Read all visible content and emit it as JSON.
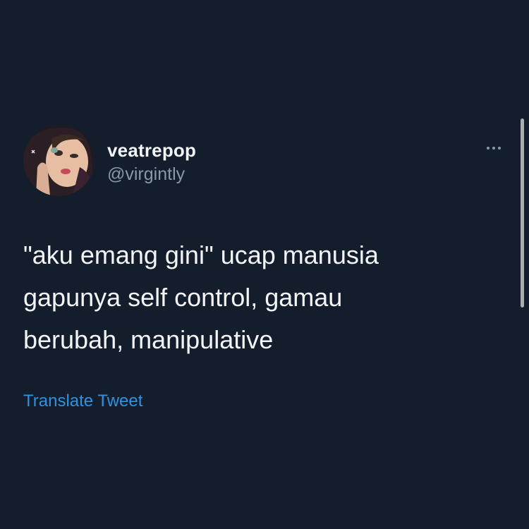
{
  "tweet": {
    "display_name": "veatrepop",
    "handle": "@virgintly",
    "text_lines": [
      "\"aku emang gini\" ucap manusia",
      "gapunya self control, gamau",
      "berubah, manipulative"
    ],
    "translate_label": "Translate Tweet",
    "more_icon": "ellipsis-icon",
    "avatar_icon": "profile-photo"
  },
  "colors": {
    "background": "#141d2b",
    "primary_text": "#f2f4f6",
    "secondary_text": "#8a97a6",
    "link": "#2f92e0"
  }
}
